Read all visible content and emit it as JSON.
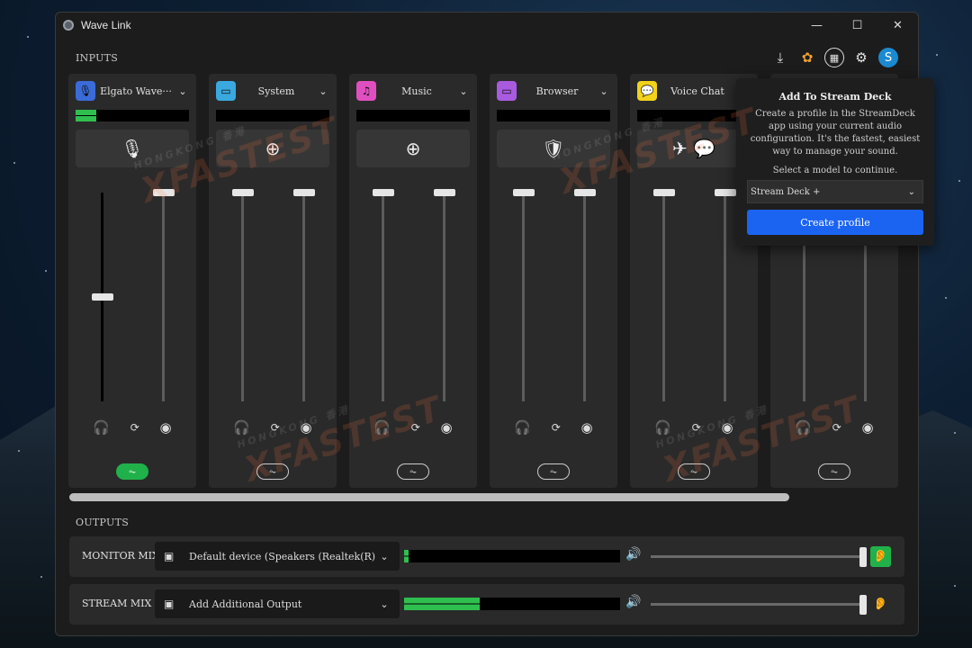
{
  "window": {
    "title": "Wave Link",
    "controls": [
      "—",
      "☐",
      "✕"
    ]
  },
  "sections": {
    "inputs": "INPUTS",
    "outputs": "OUTPUTS"
  },
  "toolbar": [
    {
      "name": "download-icon",
      "glyph": "⤓"
    },
    {
      "name": "marketplace-icon",
      "glyph": "✿"
    },
    {
      "name": "stream-deck-icon",
      "glyph": "▦"
    },
    {
      "name": "gear-icon",
      "glyph": "⚙"
    }
  ],
  "avatar": {
    "initial": "S",
    "color": "#1b8ad1"
  },
  "channels": [
    {
      "name": "Elgato Wave:3",
      "display": "Elgato Wave···",
      "icon": "microphone-icon",
      "glyph": "🎙",
      "color": "#3a6bd8",
      "meter_level": 0.18,
      "action_glyph": "🎙",
      "action_name": "microphone-icon",
      "monitor_level": 0.5,
      "stream_level": 0.0,
      "fx_on": true
    },
    {
      "name": "System",
      "icon": "monitor-icon",
      "glyph": "▭",
      "color": "#3aa9e0",
      "meter_level": 0.0,
      "action_glyph": "⊕",
      "action_name": "add-app-icon",
      "monitor_level": 0.0,
      "stream_level": 0.0,
      "fx_on": false
    },
    {
      "name": "Music",
      "icon": "music-note-icon",
      "glyph": "♫",
      "color": "#e04fc0",
      "meter_level": 0.0,
      "action_glyph": "⊕",
      "action_name": "add-app-icon",
      "monitor_level": 0.0,
      "stream_level": 0.0,
      "fx_on": false
    },
    {
      "name": "Browser",
      "icon": "browser-window-icon",
      "glyph": "▭",
      "color": "#a95be0",
      "meter_level": 0.0,
      "action_glyph": "🛡",
      "action_name": "brave-browser-icon",
      "monitor_level": 0.0,
      "stream_level": 0.0,
      "fx_on": false
    },
    {
      "name": "Voice Chat",
      "icon": "chat-bubble-icon",
      "glyph": "💬",
      "color": "#f2d21b",
      "meter_level": 0.0,
      "action_glyph": "✈ 💬",
      "action_name": "chat-apps-icon",
      "monitor_level": 0.0,
      "stream_level": 0.0,
      "fx_on": false
    },
    {
      "name": "",
      "icon": "",
      "glyph": "",
      "color": "#2a2a2a",
      "meter_level": 0.0,
      "action_glyph": "",
      "action_name": "",
      "monitor_level": 0.0,
      "stream_level": 0.0,
      "fx_on": false
    }
  ],
  "route_glyphs": {
    "monitor": "🎧",
    "link": "⟳",
    "stream": "◉"
  },
  "fx_glyph": "⏦",
  "popover": {
    "title": "Add To Stream Deck",
    "body": "Create a profile in the StreamDeck app using your current audio configuration. It's the fastest, easiest way to manage your sound.",
    "prompt": "Select a model to continue.",
    "model": "Stream Deck +",
    "button": "Create profile"
  },
  "outputs": [
    {
      "label": "MONITOR MIX",
      "device": "Default device (Speakers (Realtek(R) Audio))",
      "meter_level": 0.02,
      "volume": 1.0,
      "listen_on": true
    },
    {
      "label": "STREAM MIX",
      "device": "Add Additional Output",
      "meter_level": 0.35,
      "volume": 1.0,
      "listen_on": false
    }
  ],
  "watermark": {
    "big": "XFASTEST",
    "small": "HONGKONG 香港"
  }
}
